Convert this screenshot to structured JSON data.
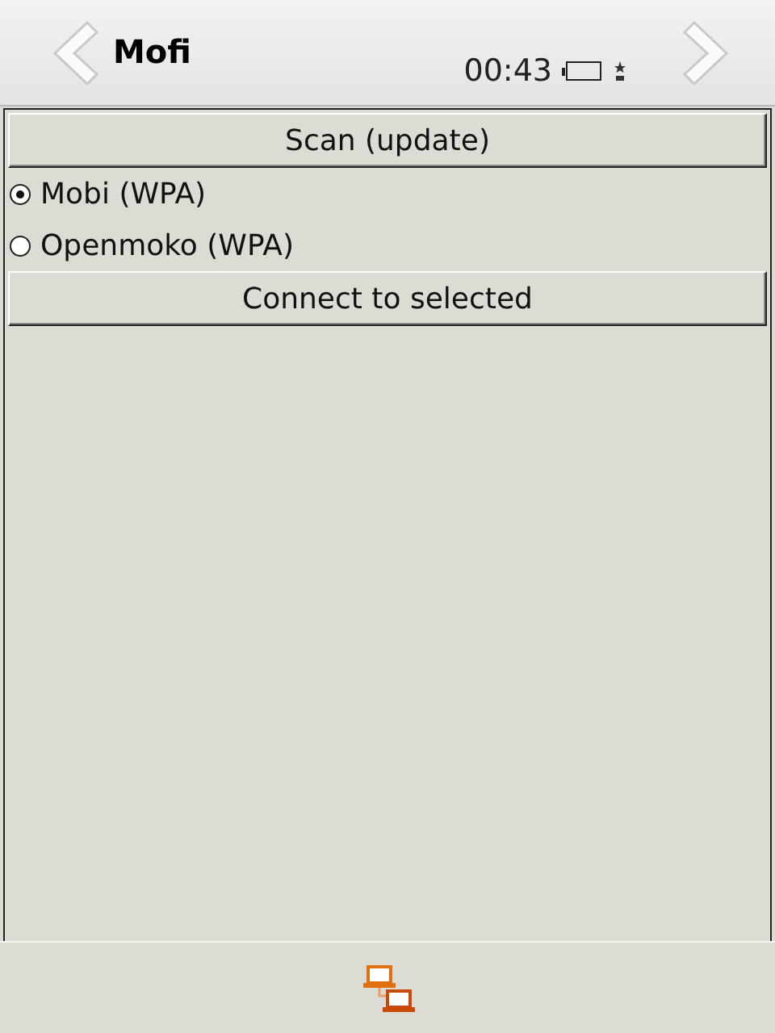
{
  "header": {
    "title": "Mofi",
    "clock": "00:43"
  },
  "scan_button": "Scan (update)",
  "networks": [
    {
      "label": "Mobi (WPA)",
      "selected": true
    },
    {
      "label": "Openmoko (WPA)",
      "selected": false
    }
  ],
  "connect_button": "Connect to selected"
}
